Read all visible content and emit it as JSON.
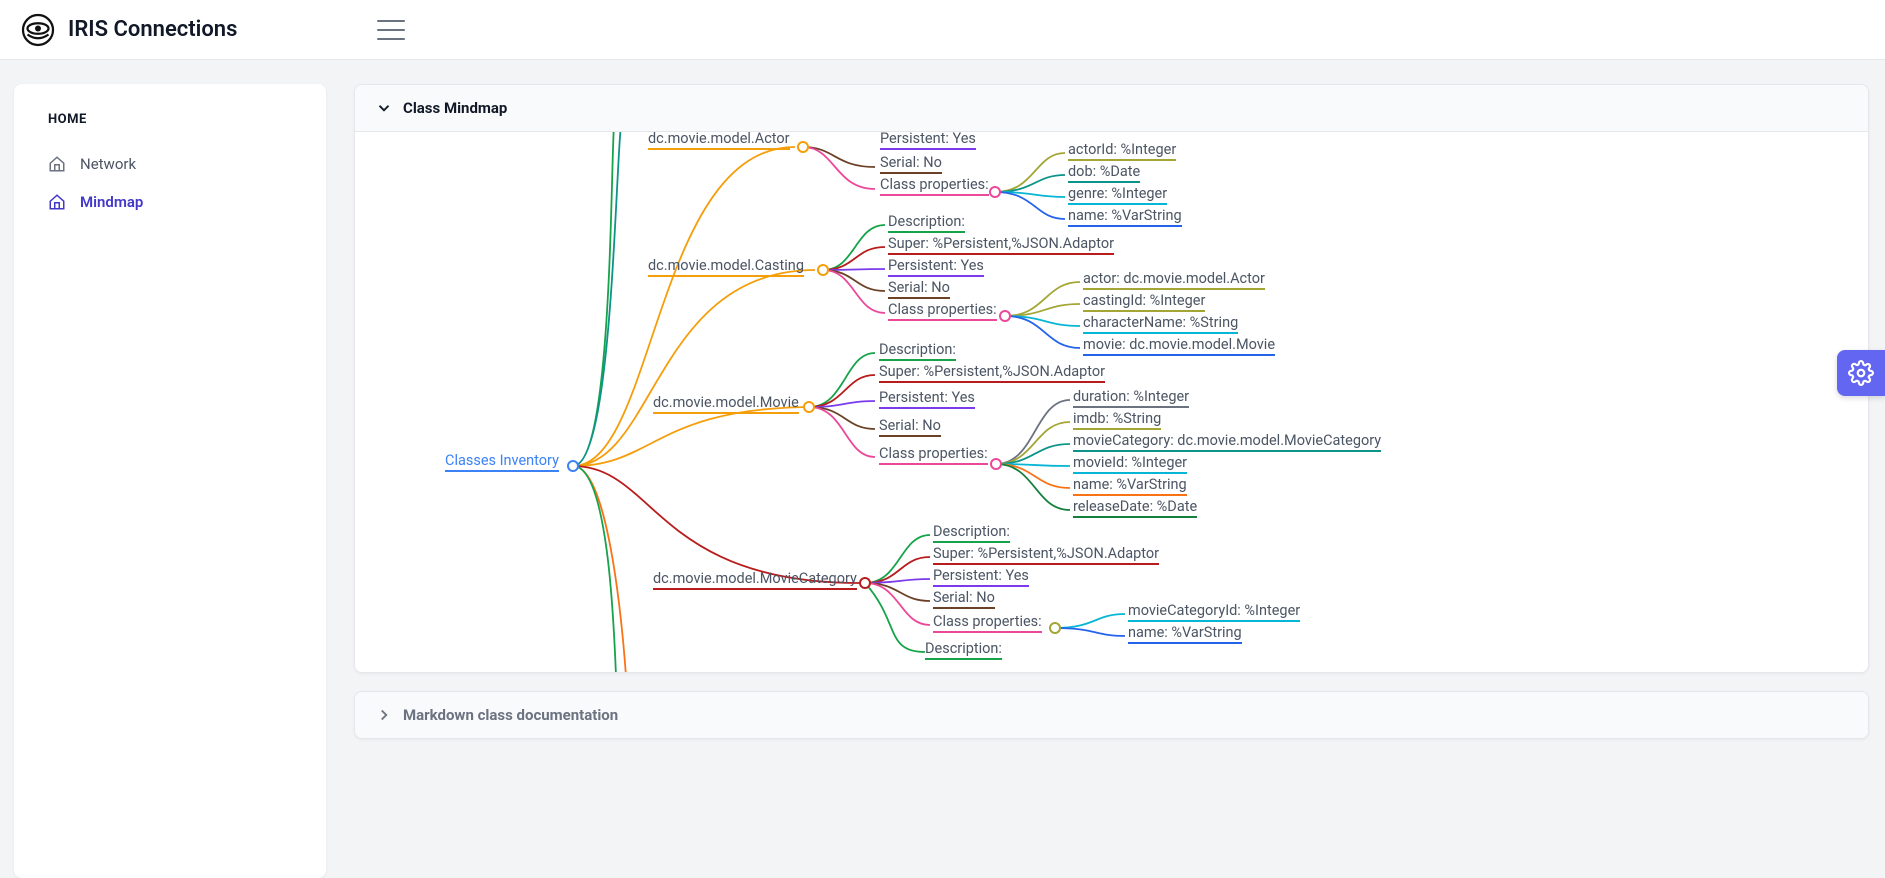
{
  "app_title": "IRIS Connections",
  "sidebar": {
    "heading": "HOME",
    "items": [
      {
        "label": "Network",
        "active": false
      },
      {
        "label": "Mindmap",
        "active": true
      }
    ]
  },
  "panels": {
    "mindmap_title": "Class Mindmap",
    "docs_title": "Markdown class documentation"
  },
  "mindmap": {
    "root": "Classes Inventory",
    "classes": [
      {
        "name": "dc.movie.model.Actor",
        "attrs": {
          "persistent": "Persistent: Yes",
          "serial": "Serial: No",
          "props_label": "Class properties:"
        },
        "props": [
          "actorId: %Integer",
          "dob: %Date",
          "genre: %Integer",
          "name: %VarString"
        ]
      },
      {
        "name": "dc.movie.model.Casting",
        "attrs": {
          "description": "Description:",
          "super": "Super: %Persistent,%JSON.Adaptor",
          "persistent": "Persistent: Yes",
          "serial": "Serial: No",
          "props_label": "Class properties:"
        },
        "props": [
          "actor: dc.movie.model.Actor",
          "castingId: %Integer",
          "characterName: %String",
          "movie: dc.movie.model.Movie"
        ]
      },
      {
        "name": "dc.movie.model.Movie",
        "attrs": {
          "description": "Description:",
          "super": "Super: %Persistent,%JSON.Adaptor",
          "persistent": "Persistent: Yes",
          "serial": "Serial: No",
          "props_label": "Class properties:"
        },
        "props": [
          "duration: %Integer",
          "imdb: %String",
          "movieCategory: dc.movie.model.MovieCategory",
          "movieId: %Integer",
          "name: %VarString",
          "releaseDate: %Date"
        ]
      },
      {
        "name": "dc.movie.model.MovieCategory",
        "attrs": {
          "description": "Description:",
          "super": "Super: %Persistent,%JSON.Adaptor",
          "persistent": "Persistent: Yes",
          "serial": "Serial: No",
          "props_label": "Class properties:"
        },
        "props": [
          "movieCategoryId: %Integer",
          "name: %VarString"
        ]
      }
    ],
    "trailing_description": "Description:"
  }
}
